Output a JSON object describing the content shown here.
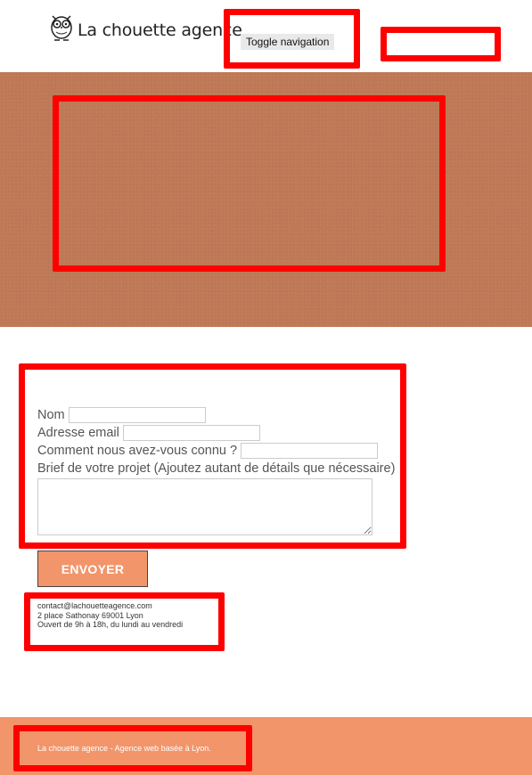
{
  "header": {
    "brand": "La chouette agence",
    "toggle_label": "Toggle navigation"
  },
  "form": {
    "name_label": "Nom",
    "email_label": "Adresse email",
    "source_label": "Comment nous avez-vous connu ?",
    "brief_label": "Brief de votre projet (Ajoutez autant de détails que nécessaire)",
    "submit_label": "ENVOYER"
  },
  "contact": {
    "email": "contact@lachouetteagence.com",
    "address": "2 place Sathonay 69001 Lyon",
    "hours": "Ouvert de 9h à 18h, du lundi au vendredi"
  },
  "footer": {
    "text": "La chouette agence - Agence web basée à Lyon."
  },
  "colors": {
    "hero": "#c07a58",
    "accent": "#f2956a",
    "highlight_box": "#ff0000"
  }
}
